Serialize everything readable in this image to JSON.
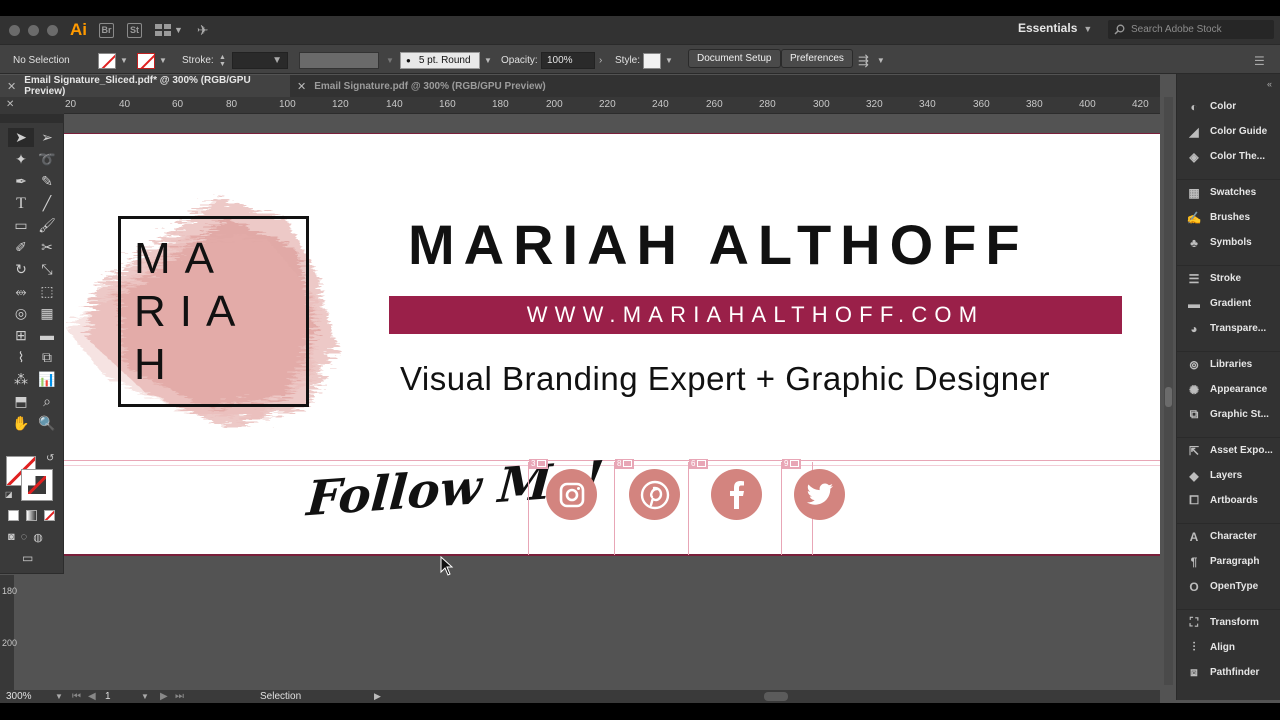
{
  "app": {
    "logo": "Ai",
    "bridge_icon": "Br",
    "stock_icon": "St",
    "workspace": "Essentials",
    "search_placeholder": "Search Adobe Stock",
    "accent": "#ff9a00"
  },
  "control_bar": {
    "selection_status": "No Selection",
    "stroke_label": "Stroke:",
    "brush_value": "5 pt. Round",
    "opacity_label": "Opacity:",
    "opacity_value": "100%",
    "style_label": "Style:",
    "document_setup": "Document Setup",
    "preferences": "Preferences"
  },
  "tabs": [
    {
      "label": "Email Signature_Sliced.pdf* @ 300% (RGB/GPU Preview)",
      "active": true
    },
    {
      "label": "Email Signature.pdf @ 300% (RGB/GPU Preview)",
      "active": false
    }
  ],
  "ruler": {
    "h_ticks": [
      "20",
      "40",
      "60",
      "80",
      "100",
      "120",
      "140",
      "160",
      "180",
      "200",
      "220",
      "240",
      "260",
      "280",
      "300",
      "320",
      "340",
      "360",
      "380",
      "400",
      "420"
    ],
    "v_ticks": [
      "180",
      "200"
    ]
  },
  "artwork": {
    "monogram_line1": "MA",
    "monogram_line2": "RIA",
    "monogram_line3": "H",
    "name": "MARIAH ALTHOFF",
    "website": "WWW.MARIAHALTHOFF.COM",
    "tagline": "Visual Branding Expert + Graphic Designer",
    "follow": "Follow Me!",
    "brand_color": "#9a2049",
    "social_color": "#d3847f",
    "slices": [
      "3",
      "8",
      "6",
      "9"
    ],
    "social_icons": [
      "instagram-icon",
      "pinterest-icon",
      "facebook-icon",
      "twitter-icon"
    ]
  },
  "panels": [
    {
      "group": 1,
      "items": [
        "Color",
        "Color Guide",
        "Color The..."
      ]
    },
    {
      "group": 2,
      "items": [
        "Swatches",
        "Brushes",
        "Symbols"
      ]
    },
    {
      "group": 3,
      "items": [
        "Stroke",
        "Gradient",
        "Transpare..."
      ]
    },
    {
      "group": 4,
      "items": [
        "Libraries",
        "Appearance",
        "Graphic St..."
      ]
    },
    {
      "group": 5,
      "items": [
        "Asset Expo...",
        "Layers",
        "Artboards"
      ]
    },
    {
      "group": 6,
      "items": [
        "Character",
        "Paragraph",
        "OpenType"
      ]
    },
    {
      "group": 7,
      "items": [
        "Transform",
        "Align",
        "Pathfinder"
      ]
    }
  ],
  "status_bar": {
    "zoom": "300%",
    "artboard_number": "1",
    "tool": "Selection"
  }
}
